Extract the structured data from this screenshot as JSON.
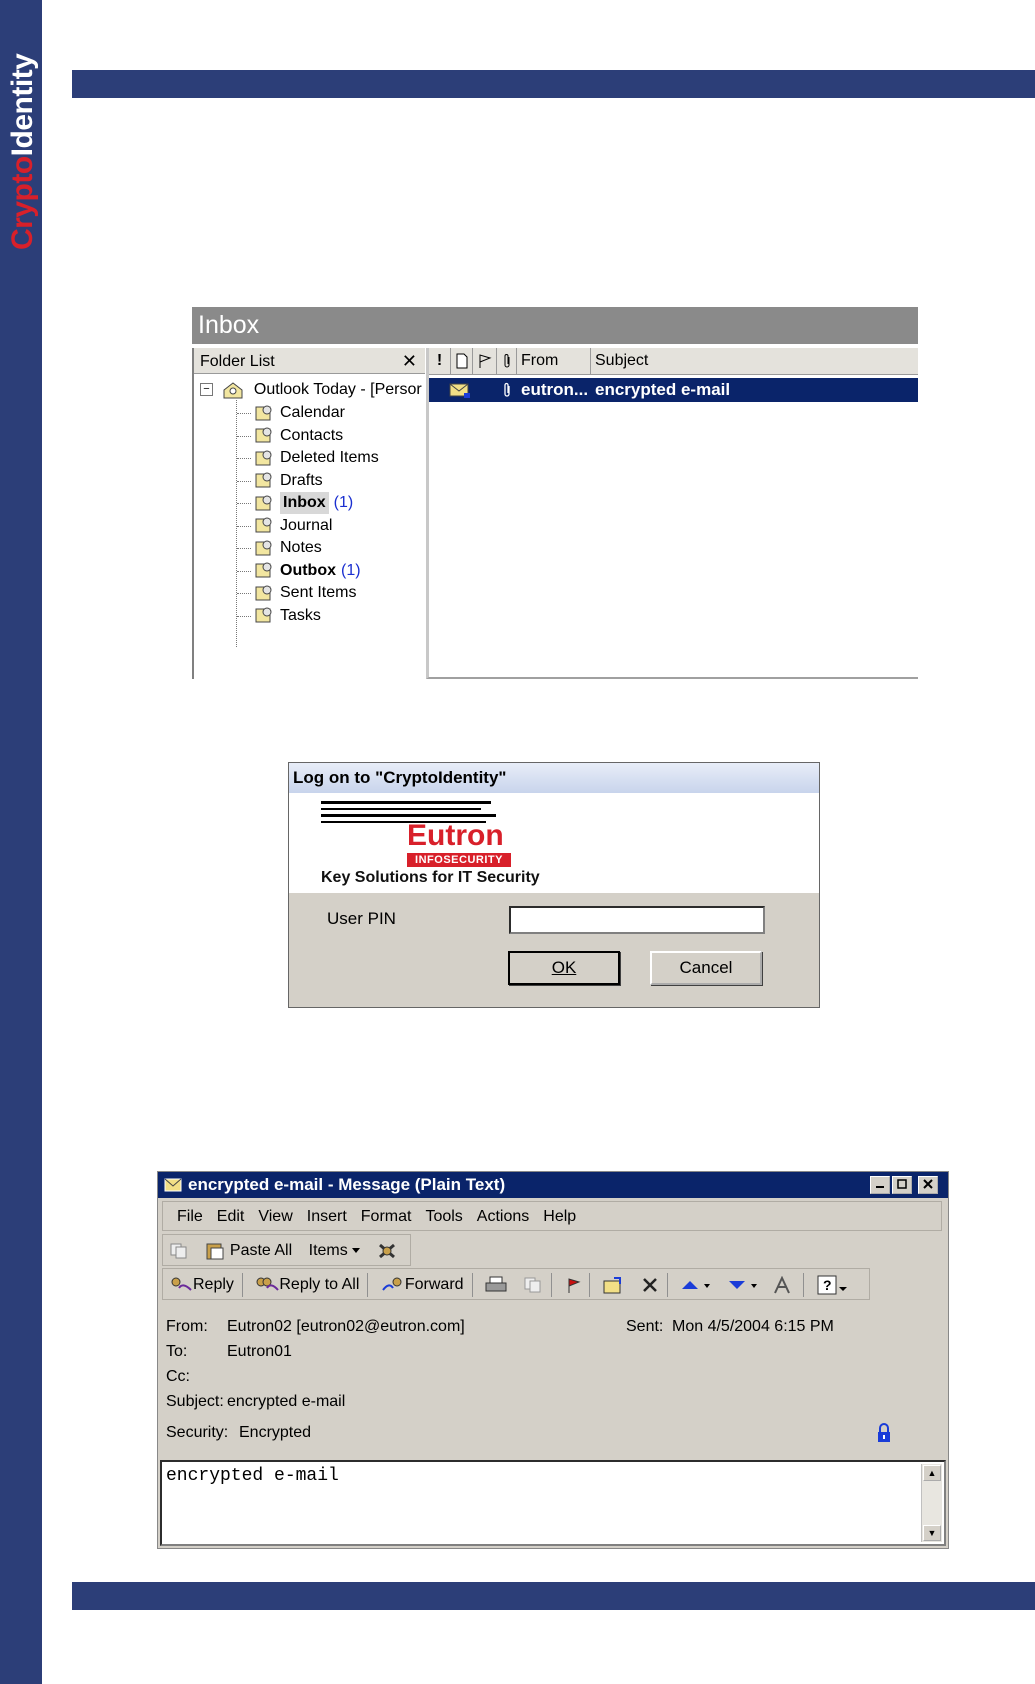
{
  "brand": {
    "crypto": "Crypto",
    "identity": "Identity",
    "strip_color": "#2c3e78",
    "accent_color": "#d8202a"
  },
  "inbox": {
    "title": "Inbox",
    "folder_list_label": "Folder List",
    "close_glyph": "✕",
    "root": "Outlook Today - [Persor",
    "folders": [
      {
        "label": "Calendar",
        "icon": "calendar-icon"
      },
      {
        "label": "Contacts",
        "icon": "contacts-icon"
      },
      {
        "label": "Deleted Items",
        "icon": "deleted-items-icon"
      },
      {
        "label": "Drafts",
        "icon": "drafts-icon"
      },
      {
        "label": "Inbox",
        "count": "(1)",
        "bold": true,
        "selected": true,
        "icon": "inbox-icon"
      },
      {
        "label": "Journal",
        "icon": "journal-icon"
      },
      {
        "label": "Notes",
        "icon": "notes-icon"
      },
      {
        "label": "Outbox",
        "count": "(1)",
        "bold": true,
        "icon": "outbox-icon"
      },
      {
        "label": "Sent Items",
        "icon": "sent-items-icon"
      },
      {
        "label": "Tasks",
        "icon": "tasks-icon"
      }
    ],
    "columns": {
      "importance": "!",
      "from": "From",
      "subject": "Subject"
    },
    "message": {
      "from": "eutron...",
      "subject": "encrypted e-mail"
    }
  },
  "logon": {
    "title": "Log on to \"CryptoIdentity\"",
    "brand": "Eutron",
    "infosecurity": "INFOSECURITY",
    "slogan": "Key Solutions for IT Security",
    "pin_label": "User PIN",
    "pin_value": "",
    "ok": "OK",
    "cancel": "Cancel"
  },
  "message_window": {
    "title": "encrypted e-mail - Message (Plain Text)",
    "menu": [
      "File",
      "Edit",
      "View",
      "Insert",
      "Format",
      "Tools",
      "Actions",
      "Help"
    ],
    "toolbar1": {
      "paste_all": "Paste All",
      "items": "Items"
    },
    "toolbar2": {
      "reply": "Reply",
      "reply_all": "Reply to All",
      "forward": "Forward"
    },
    "header": {
      "from_label": "From:",
      "from": "Eutron02 [eutron02@eutron.com]",
      "sent_label": "Sent:",
      "sent": "Mon 4/5/2004 6:15 PM",
      "to_label": "To:",
      "to": "Eutron01",
      "cc_label": "Cc:",
      "cc": "",
      "subject_label": "Subject:",
      "subject": "encrypted e-mail",
      "security_label": "Security:",
      "security": "Encrypted"
    },
    "body": "encrypted e-mail"
  }
}
